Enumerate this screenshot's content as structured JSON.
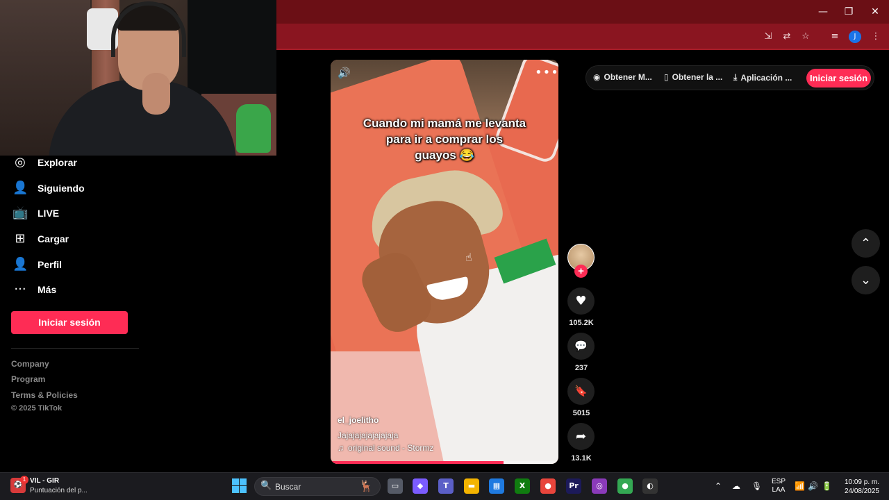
{
  "browser": {
    "window_controls": {
      "minimize": "—",
      "restore": "❐",
      "close": "✕"
    },
    "toolbar_icons": [
      "install-app-icon",
      "translate-icon",
      "star-icon",
      "media-control-icon",
      "profile-icon",
      "menu-icon"
    ],
    "profile_initial": "J",
    "accent_color": "#8a1520"
  },
  "sidebar": {
    "items": [
      {
        "label": "Explorar",
        "icon": "compass-icon",
        "glyph": "◎"
      },
      {
        "label": "Siguiendo",
        "icon": "user-follow-icon",
        "glyph": "👤"
      },
      {
        "label": "LIVE",
        "icon": "live-tv-icon",
        "glyph": "📺"
      },
      {
        "label": "Cargar",
        "icon": "upload-plus-icon",
        "glyph": "⊞"
      },
      {
        "label": "Perfil",
        "icon": "person-icon",
        "glyph": "👤"
      },
      {
        "label": "Más",
        "icon": "more-dots-icon",
        "glyph": "···"
      }
    ],
    "login_label": "Iniciar sesión",
    "footer": [
      "Company",
      "Program",
      "Terms & Policies",
      "© 2025 TikTok"
    ]
  },
  "video": {
    "caption_line1": "Cuando mi mamá me levanta",
    "caption_line2": "para ir a comprar los",
    "caption_line3": "guayos 😂",
    "author": "el_joelitho",
    "description": "Jajajajajajajajaja",
    "music_icon": "♫",
    "music": "original sound - Stormz",
    "progress": 0.76,
    "sound_glyph": "🔊",
    "more_glyph": "•••"
  },
  "actions": {
    "follow_glyph": "+",
    "like": {
      "glyph": "♥",
      "count": "105.2K"
    },
    "comment": {
      "glyph": "💬",
      "count": "237"
    },
    "save": {
      "glyph": "🔖",
      "count": "5015"
    },
    "share": {
      "glyph": "➦",
      "count": "13.1K"
    }
  },
  "topbar": {
    "links": [
      {
        "label": "Obtener M...",
        "glyph": "◉"
      },
      {
        "label": "Obtener la ...",
        "glyph": "▯"
      },
      {
        "label": "Aplicación ...",
        "glyph": "⤓"
      }
    ],
    "login_label": "Iniciar sesión"
  },
  "feed_nav": {
    "up": "⌃",
    "down": "⌄"
  },
  "taskbar": {
    "widget_badge": "1",
    "widget_title": "VIL - GIR",
    "widget_subtitle": "Puntuación del p...",
    "search_placeholder": "Buscar",
    "search_glyph": "🔍",
    "apps": [
      {
        "name": "task-view-icon",
        "glyph": "▭",
        "color": "#555a66"
      },
      {
        "name": "copilot-icon",
        "glyph": "◆",
        "color": "#7b5cff"
      },
      {
        "name": "teams-icon",
        "glyph": "T",
        "color": "#5b5fc7"
      },
      {
        "name": "file-explorer-icon",
        "glyph": "▬",
        "color": "#f4b400"
      },
      {
        "name": "store-icon",
        "glyph": "▦",
        "color": "#1f7ae0"
      },
      {
        "name": "xbox-icon",
        "glyph": "X",
        "color": "#107c10"
      },
      {
        "name": "chrome-icon",
        "glyph": "●",
        "color": "#e8453c"
      },
      {
        "name": "premiere-icon",
        "glyph": "Pr",
        "color": "#1c1a5a"
      },
      {
        "name": "instagram-icon",
        "glyph": "◎",
        "color": "#8a3ab9"
      },
      {
        "name": "chrome-active-icon",
        "glyph": "●",
        "color": "#34a853"
      },
      {
        "name": "obs-icon",
        "glyph": "◐",
        "color": "#333333"
      }
    ],
    "lang_top": "ESP",
    "lang_bottom": "LAA",
    "time": "10:09 p. m.",
    "date": "24/08/2025",
    "tray_glyphs": {
      "chevron": "⌃",
      "onedrive": "☁",
      "mic": "🎙",
      "wifi": "📶",
      "volume": "🔊",
      "battery": "🔋"
    }
  }
}
